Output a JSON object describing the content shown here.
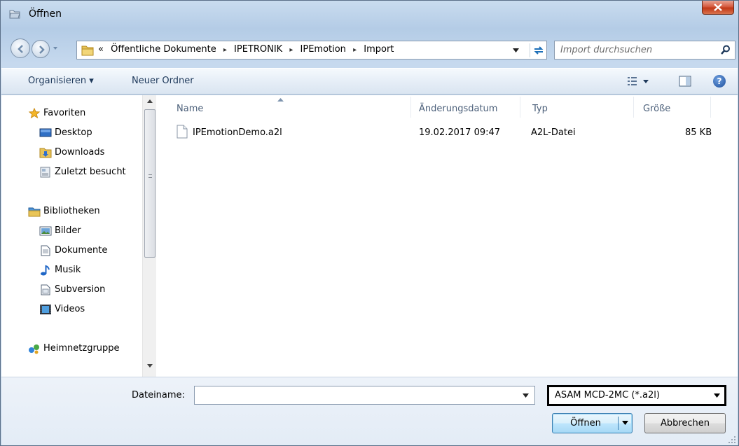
{
  "window": {
    "title": "Öffnen",
    "close_icon": "close-icon"
  },
  "address": {
    "prefix": "«",
    "crumbs": [
      "Öffentliche Dokumente",
      "IPETRONIK",
      "IPEmotion",
      "Import"
    ],
    "separator": "▸"
  },
  "search": {
    "placeholder": "Import durchsuchen"
  },
  "toolbar": {
    "organize_label": "Organisieren ▾",
    "new_folder_label": "Neuer Ordner",
    "help_label": "?"
  },
  "sidebar": {
    "favorites": "Favoriten",
    "favorites_items": [
      "Desktop",
      "Downloads",
      "Zuletzt besucht"
    ],
    "libraries": "Bibliotheken",
    "library_items": [
      "Bilder",
      "Dokumente",
      "Musik",
      "Subversion",
      "Videos"
    ],
    "homegroup": "Heimnetzgruppe"
  },
  "files": {
    "columns": [
      "Name",
      "Änderungsdatum",
      "Typ",
      "Größe"
    ],
    "rows": [
      {
        "name": "IPEmotionDemo.a2l",
        "date": "19.02.2017 09:47",
        "type": "A2L-Datei",
        "size": "85 KB"
      }
    ]
  },
  "bottom": {
    "filename_label": "Dateiname:",
    "filename_value": "",
    "filter_value": "ASAM MCD-2MC (*.a2l)",
    "open_label": "Öffnen",
    "cancel_label": "Abbrechen"
  },
  "colors": {
    "accent": "#3c7fb1",
    "titlebar": "#b4cce6",
    "close": "#c13817"
  }
}
